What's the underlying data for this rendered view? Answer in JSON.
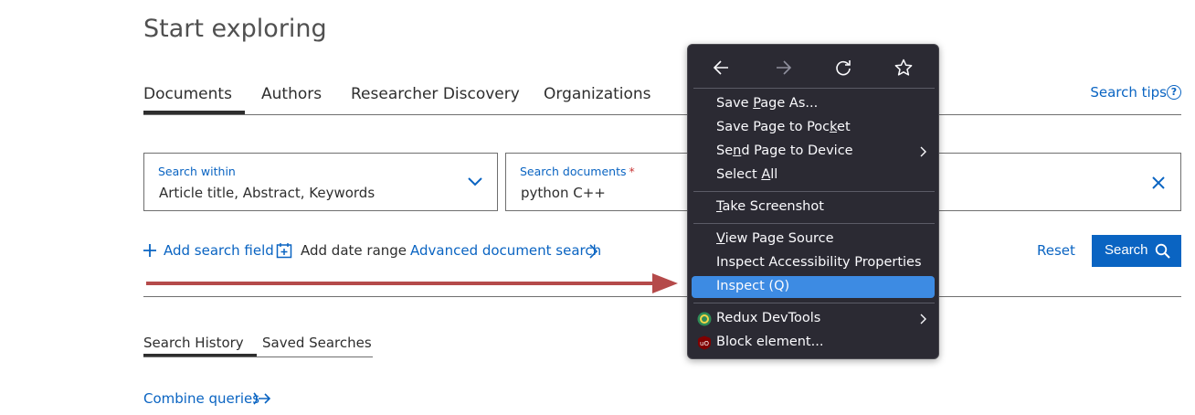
{
  "page": {
    "title": "Start exploring"
  },
  "tabs": [
    {
      "label": "Documents",
      "active": true
    },
    {
      "label": "Authors",
      "active": false
    },
    {
      "label": "Researcher Discovery",
      "active": false
    },
    {
      "label": "Organizations",
      "active": false
    }
  ],
  "search_tips": {
    "label": "Search tips",
    "icon": "help-circle-icon"
  },
  "search_within": {
    "label": "Search within",
    "value": "Article title, Abstract, Keywords"
  },
  "search_documents": {
    "label": "Search documents",
    "required_mark": "*",
    "value": "python C++"
  },
  "actions": {
    "add_field": "Add search field",
    "add_date": "Add date range",
    "advanced": "Advanced document search",
    "reset": "Reset",
    "search": "Search"
  },
  "history_tabs": [
    {
      "label": "Search History",
      "active": true
    },
    {
      "label": "Saved Searches",
      "active": false
    }
  ],
  "combine": "Combine queries",
  "colors": {
    "accent": "#0a64c2",
    "menu_bg": "#2b2a33",
    "menu_highlight": "#3d8be3",
    "arrow": "#b54a4a"
  },
  "context_menu": {
    "nav": [
      "back-icon",
      "forward-icon",
      "reload-icon",
      "bookmark-star-icon"
    ],
    "items": {
      "save_page_as": {
        "pre": "Save ",
        "key": "P",
        "post": "age As..."
      },
      "save_to_pocket": {
        "pre": "Save Page to Poc",
        "key": "k",
        "post": "et"
      },
      "send_to_device": {
        "pre": "Se",
        "key": "n",
        "post": "d Page to Device"
      },
      "select_all": {
        "pre": "Select ",
        "key": "A",
        "post": "ll"
      },
      "take_screenshot": {
        "pre": "",
        "key": "T",
        "post": "ake Screenshot"
      },
      "view_source": {
        "pre": "",
        "key": "V",
        "post": "iew Page Source"
      },
      "inspect_accessibility": {
        "pre": "Inspect Accessibility Properties",
        "key": "",
        "post": ""
      },
      "inspect": {
        "pre": "Inspect (Q)",
        "key": "",
        "post": ""
      },
      "redux": {
        "pre": "Redux DevTools",
        "key": "",
        "post": ""
      },
      "block": {
        "pre": "Block element...",
        "key": "",
        "post": ""
      }
    },
    "highlighted": "inspect"
  }
}
